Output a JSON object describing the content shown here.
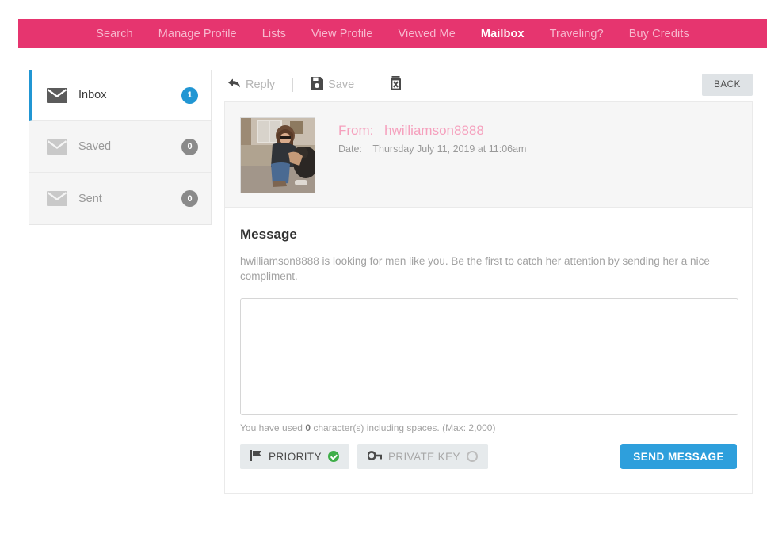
{
  "nav": {
    "items": [
      {
        "label": "Search",
        "active": false
      },
      {
        "label": "Manage Profile",
        "active": false
      },
      {
        "label": "Lists",
        "active": false
      },
      {
        "label": "View Profile",
        "active": false
      },
      {
        "label": "Viewed Me",
        "active": false
      },
      {
        "label": "Mailbox",
        "active": true
      },
      {
        "label": "Traveling?",
        "active": false
      },
      {
        "label": "Buy Credits",
        "active": false
      }
    ],
    "bar_color": "#e6356f",
    "active_color": "#ffffff",
    "inactive_color": "#f7b8ce"
  },
  "sidebar": {
    "folders": [
      {
        "label": "Inbox",
        "count": "1",
        "active": true,
        "icon": "envelope-icon"
      },
      {
        "label": "Saved",
        "count": "0",
        "active": false,
        "icon": "envelope-icon"
      },
      {
        "label": "Sent",
        "count": "0",
        "active": false,
        "icon": "envelope-icon"
      }
    ],
    "active_badge_color": "#2196d3",
    "inactive_badge_color": "#8a8a8a"
  },
  "toolbar": {
    "reply_label": "Reply",
    "save_label": "Save",
    "delete_icon": "trash-icon",
    "back_label": "BACK"
  },
  "message": {
    "from_label": "From:",
    "from_user": "hwilliamson8888",
    "date_label": "Date:",
    "date_value": "Thursday July 11, 2019 at 11:06am",
    "avatar_alt": "sender-photo",
    "section_title": "Message",
    "body": "hwilliamson8888 is looking for men like you. Be the first to catch her attention by sending her a nice compliment.",
    "accent_color": "#f5a0bd"
  },
  "compose": {
    "reply_value": "",
    "reply_placeholder": "",
    "counter_prefix": "You have used",
    "counter_count": "0",
    "counter_suffix": "character(s) including spaces. (Max: 2,000)",
    "priority_label": "PRIORITY",
    "priority_on": true,
    "private_key_label": "PRIVATE KEY",
    "private_key_on": false,
    "send_label": "SEND MESSAGE",
    "send_color": "#2e9fdc",
    "check_color": "#3fae49"
  }
}
